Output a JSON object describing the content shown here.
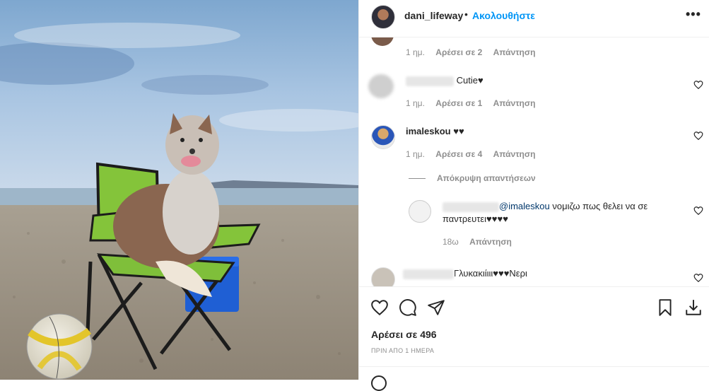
{
  "post": {
    "username": "dani_lifeway",
    "separator": "•",
    "follow_label": "Ακολουθήστε",
    "more_label": "•••"
  },
  "comments": [
    {
      "id": "c0",
      "meta": {
        "time": "1 ημ.",
        "likes": "Αρέσει σε 2",
        "reply": "Απάντηση"
      }
    },
    {
      "id": "c1",
      "text": "Cutie♥",
      "meta": {
        "time": "1 ημ.",
        "likes": "Αρέσει σε 1",
        "reply": "Απάντηση"
      }
    },
    {
      "id": "c2",
      "username": "imaleskou",
      "text": "♥♥",
      "meta": {
        "time": "1 ημ.",
        "likes": "Αρέσει σε 4",
        "reply": "Απάντηση"
      }
    }
  ],
  "hide_replies_label": "Απόκρυψη απαντήσεων",
  "reply": {
    "mention": "@imaleskou",
    "text_line1": " νομιζω πως θελει να σε",
    "text_line2": "παντρευτει♥♥♥♥",
    "meta": {
      "time": "18ω",
      "reply": "Απάντηση"
    }
  },
  "comment_last": {
    "text": "Γλυκακιίιιι♥♥♥Νερι"
  },
  "actions": {
    "likes_label": "Αρέσει σε 496",
    "date_label": "ΠΡΙΝ ΑΠΟ 1 ΗΜΕΡΑ"
  },
  "icons": [
    "heart-icon",
    "comment-icon",
    "share-icon",
    "bookmark-icon",
    "download-icon",
    "more-icon"
  ],
  "colors": {
    "link_blue": "#0095f6",
    "text": "#262626",
    "muted": "#8e8e8e",
    "mention": "#00376b"
  }
}
